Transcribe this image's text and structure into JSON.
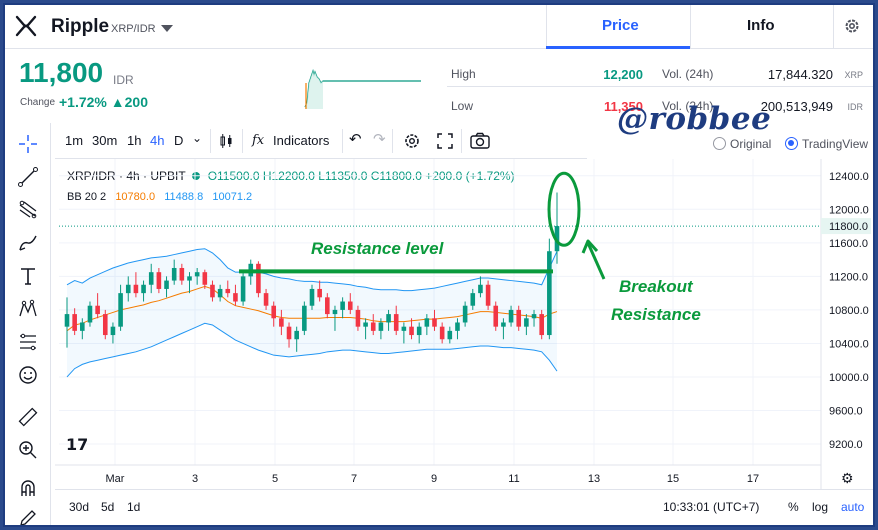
{
  "header": {
    "coin_name": "Ripple",
    "pair": "XRP/IDR",
    "tabs": [
      "Price",
      "Info"
    ],
    "active_tab": "Price"
  },
  "summary": {
    "price": "11,800",
    "currency": "IDR",
    "change_label": "Change",
    "change_pct": "+1.72%",
    "change_abs": "▲200",
    "high_label": "High",
    "high": "12,200",
    "low_label": "Low",
    "low": "11,350",
    "vol_label": "Vol. (24h)",
    "vol_xrp": "17,844.320",
    "vol_xrp_unit": "XRP",
    "vol_idr": "200,513,949",
    "vol_idr_unit": "IDR"
  },
  "toolbar": {
    "intervals": [
      "1m",
      "30m",
      "1h",
      "4h",
      "D"
    ],
    "active_interval": "4h",
    "indicators_label": "Indicators",
    "view_original": "Original",
    "view_tradingview": "TradingView"
  },
  "watermark": "@robbee",
  "legend": {
    "symbol": "XRP/IDR · 4h · UPBIT",
    "ohlc": "O11500.0 H12200.0 L11350.0 C11800.0 +200.0 (+1.72%)",
    "bb_label": "BB 20 2",
    "bb_mid": "10780.0",
    "bb_up": "11488.8",
    "bb_low": "10071.2"
  },
  "annotations": {
    "resistance": "Resistance level",
    "breakout_1": "Breakout",
    "breakout_2": "Resistance"
  },
  "bottom": {
    "ranges": [
      "30d",
      "5d",
      "1d"
    ],
    "time": "10:33:01 (UTC+7)",
    "pct": "%",
    "log": "log",
    "auto": "auto"
  },
  "chart_data": {
    "type": "candlestick",
    "y_ticks": [
      "12400.0",
      "12000.0",
      "11600.0",
      "11200.0",
      "10800.0",
      "10400.0",
      "10000.0",
      "9600.0",
      "9200.0"
    ],
    "y_tick_values": [
      12400,
      12000,
      11600,
      11200,
      10800,
      10400,
      10000,
      9600,
      9200
    ],
    "current_price_label": "11800.0",
    "current_price": 11800,
    "x_ticks": [
      "Mar",
      "3",
      "5",
      "7",
      "9",
      "11",
      "13",
      "15",
      "17"
    ],
    "ylim": [
      8950,
      12600
    ],
    "candles": [
      [
        10600,
        10950,
        10350,
        10750
      ],
      [
        10750,
        10820,
        10500,
        10550
      ],
      [
        10550,
        10700,
        10450,
        10650
      ],
      [
        10650,
        10900,
        10600,
        10850
      ],
      [
        10850,
        11000,
        10700,
        10750
      ],
      [
        10750,
        10800,
        10450,
        10500
      ],
      [
        10500,
        10650,
        10400,
        10600
      ],
      [
        10600,
        11100,
        10550,
        11000
      ],
      [
        11000,
        11200,
        10900,
        11100
      ],
      [
        11100,
        11250,
        10950,
        11000
      ],
      [
        11000,
        11150,
        10900,
        11100
      ],
      [
        11100,
        11350,
        11000,
        11250
      ],
      [
        11250,
        11300,
        11000,
        11050
      ],
      [
        11050,
        11200,
        10950,
        11150
      ],
      [
        11150,
        11400,
        11100,
        11300
      ],
      [
        11300,
        11350,
        11100,
        11150
      ],
      [
        11150,
        11250,
        11000,
        11200
      ],
      [
        11200,
        11300,
        11100,
        11250
      ],
      [
        11250,
        11280,
        11050,
        11100
      ],
      [
        11100,
        11150,
        10900,
        10950
      ],
      [
        10950,
        11100,
        10900,
        11050
      ],
      [
        11050,
        11150,
        10950,
        11000
      ],
      [
        11000,
        11100,
        10850,
        10900
      ],
      [
        10900,
        11250,
        10850,
        11200
      ],
      [
        11200,
        11400,
        11100,
        11350
      ],
      [
        11350,
        11380,
        10950,
        11000
      ],
      [
        11000,
        11050,
        10800,
        10850
      ],
      [
        10850,
        10900,
        10600,
        10700
      ],
      [
        10700,
        10800,
        10500,
        10600
      ],
      [
        10600,
        10650,
        10350,
        10450
      ],
      [
        10450,
        10600,
        10300,
        10550
      ],
      [
        10550,
        10900,
        10500,
        10850
      ],
      [
        10850,
        11100,
        10800,
        11050
      ],
      [
        11050,
        11150,
        10900,
        10950
      ],
      [
        10950,
        11000,
        10700,
        10750
      ],
      [
        10750,
        10850,
        10550,
        10800
      ],
      [
        10800,
        10950,
        10700,
        10900
      ],
      [
        10900,
        11000,
        10750,
        10800
      ],
      [
        10800,
        10850,
        10550,
        10600
      ],
      [
        10600,
        10700,
        10450,
        10650
      ],
      [
        10650,
        10750,
        10500,
        10550
      ],
      [
        10550,
        10700,
        10450,
        10650
      ],
      [
        10650,
        10800,
        10550,
        10750
      ],
      [
        10750,
        10850,
        10500,
        10550
      ],
      [
        10550,
        10650,
        10400,
        10600
      ],
      [
        10600,
        10700,
        10450,
        10500
      ],
      [
        10500,
        10650,
        10400,
        10600
      ],
      [
        10600,
        10750,
        10500,
        10700
      ],
      [
        10700,
        10800,
        10550,
        10600
      ],
      [
        10600,
        10650,
        10400,
        10450
      ],
      [
        10450,
        10600,
        10400,
        10550
      ],
      [
        10550,
        10700,
        10450,
        10650
      ],
      [
        10650,
        10900,
        10600,
        10850
      ],
      [
        10850,
        11050,
        10800,
        11000
      ],
      [
        11000,
        11200,
        10950,
        11100
      ],
      [
        11100,
        11150,
        10800,
        10850
      ],
      [
        10850,
        10900,
        10550,
        10600
      ],
      [
        10600,
        10700,
        10450,
        10650
      ],
      [
        10650,
        10850,
        10600,
        10800
      ],
      [
        10800,
        10850,
        10550,
        10600
      ],
      [
        10600,
        10750,
        10500,
        10700
      ],
      [
        10700,
        10800,
        10600,
        10750
      ],
      [
        10750,
        10800,
        10450,
        10500
      ],
      [
        10500,
        11650,
        10450,
        11500
      ],
      [
        11500,
        12200,
        11350,
        11800
      ]
    ],
    "bb_upper": [
      11100,
      11150,
      11120,
      11180,
      11220,
      11260,
      11300,
      11330,
      11360,
      11380,
      11400,
      11420,
      11430,
      11440,
      11460,
      11480,
      11500,
      11520,
      11530,
      11480,
      11400,
      11300,
      11250,
      11250,
      11260,
      11250,
      11230,
      11200,
      11180,
      11170,
      11150,
      11140,
      11140,
      11130,
      11130,
      11120,
      11110,
      11100,
      11080,
      11070,
      11050,
      11040,
      11040,
      11040,
      11030,
      11030,
      11040,
      11050,
      11060,
      11080,
      11100,
      11120,
      11140,
      11160,
      11180,
      11180,
      11170,
      11160,
      11150,
      11140,
      11130,
      11120,
      11100,
      11300,
      11500
    ],
    "bb_lower": [
      10000,
      10100,
      10150,
      10180,
      10200,
      10220,
      10240,
      10260,
      10280,
      10300,
      10330,
      10360,
      10400,
      10440,
      10480,
      10520,
      10560,
      10600,
      10640,
      10620,
      10560,
      10500,
      10440,
      10400,
      10360,
      10320,
      10290,
      10260,
      10250,
      10240,
      10250,
      10260,
      10270,
      10280,
      10300,
      10310,
      10320,
      10320,
      10310,
      10300,
      10290,
      10280,
      10280,
      10290,
      10300,
      10310,
      10320,
      10330,
      10330,
      10330,
      10330,
      10340,
      10350,
      10360,
      10370,
      10370,
      10360,
      10350,
      10350,
      10340,
      10330,
      10320,
      10300,
      10200,
      10070
    ],
    "bb_mid": [
      10550,
      10620,
      10640,
      10680,
      10710,
      10740,
      10770,
      10800,
      10820,
      10840,
      10860,
      10890,
      10910,
      10940,
      10970,
      11000,
      11020,
      11050,
      11080,
      11050,
      10980,
      10900,
      10850,
      10830,
      10810,
      10790,
      10760,
      10730,
      10710,
      10700,
      10700,
      10700,
      10700,
      10700,
      10710,
      10710,
      10710,
      10710,
      10700,
      10690,
      10670,
      10660,
      10660,
      10660,
      10660,
      10670,
      10680,
      10690,
      10690,
      10700,
      10710,
      10720,
      10740,
      10760,
      10780,
      10780,
      10770,
      10760,
      10750,
      10740,
      10730,
      10720,
      10700,
      10750,
      10780
    ]
  },
  "colors": {
    "up": "#089981",
    "down": "#f23645",
    "accent": "#2962ff",
    "annotation": "#0a9a3c",
    "bb_band": "#2196f3",
    "bb_mid": "#f57c00"
  }
}
